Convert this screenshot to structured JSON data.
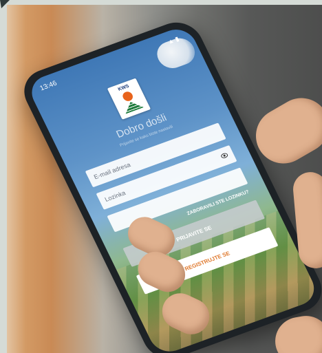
{
  "phone": {
    "status_time": "13:46",
    "status_icons": "▲ ▮",
    "logo_text": "KWS",
    "welcome_title": "Dobro došli",
    "welcome_subtitle": "Prijavite se kako biste nastavili",
    "email_placeholder": "E-mail adresa",
    "password_placeholder": "Lozinka",
    "forgot_password": "ZABORAVILI STE LOZINKU?",
    "login_button": "PRIJAVITE SE",
    "register_button": "REGISTRUJTE SE"
  },
  "colors": {
    "brand_orange": "#e07a2f",
    "sky_blue": "#3f78b6",
    "field_green": "#6f9a4e"
  }
}
